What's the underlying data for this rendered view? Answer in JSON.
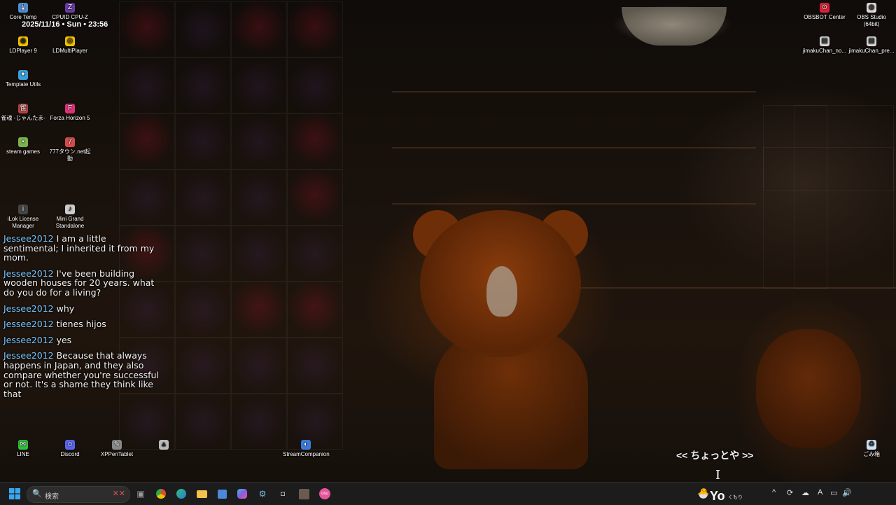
{
  "clock": "2025/11/16 • Sun • 23:56",
  "desktop_icons": [
    {
      "label": "Core Temp",
      "icon": "thermometer-icon",
      "color": "#4a90d9"
    },
    {
      "label": "CPUID CPU-Z",
      "icon": "cpu-z-icon",
      "color": "#6a3aa8"
    },
    {
      "label": "LDPlayer 9",
      "icon": "ldplayer-icon",
      "color": "#f2c200"
    },
    {
      "label": "LDMultiPlayer",
      "icon": "ldmultiplayer-icon",
      "color": "#f2c200"
    },
    {
      "label": "Template Utils",
      "icon": "template-utils-icon",
      "color": "#3aa0d8"
    },
    {
      "label": "雀魂 -じゃんたま-",
      "icon": "mahjong-game-icon",
      "color": "#b84040"
    },
    {
      "label": "Forza Horizon 5",
      "icon": "forza-icon",
      "color": "#e0307a"
    },
    {
      "label": "steam games",
      "icon": "folder-icon",
      "color": "#7ab34a"
    },
    {
      "label": "777タウン.net起動",
      "icon": "slot-town-icon",
      "color": "#d84a4a"
    },
    {
      "label": "iLok License Manager",
      "icon": "ilok-icon",
      "color": "#444444"
    },
    {
      "label": "Mini Grand Standalone",
      "icon": "piano-icon",
      "color": "#cccccc"
    },
    {
      "label": "LINE",
      "icon": "line-icon",
      "color": "#2fbf3a"
    },
    {
      "label": "Discord",
      "icon": "discord-icon",
      "color": "#5865f2"
    },
    {
      "label": "XPPenTablet",
      "icon": "tablet-icon",
      "color": "#888888"
    },
    {
      "label": "",
      "icon": "app-icon",
      "color": "#bbbbbb"
    },
    {
      "label": "StreamCompanion",
      "icon": "stream-companion-icon",
      "color": "#3a7ad8"
    },
    {
      "label": "OBSBOT Center",
      "icon": "obsbot-icon",
      "color": "#e0203a"
    },
    {
      "label": "OBS Studio (64bit)",
      "icon": "obs-icon",
      "color": "#dddddd"
    },
    {
      "label": "jimakuChan_no...",
      "icon": "file-icon",
      "color": "#dddddd"
    },
    {
      "label": "jimakuChan_pre...",
      "icon": "file-icon",
      "color": "#dddddd"
    },
    {
      "label": "ごみ箱",
      "icon": "recycle-bin-icon",
      "color": "#cfe3f5"
    }
  ],
  "chat": [
    {
      "user": "Jessee2012",
      "text": "I am a little sentimental; I inherited it from my mom."
    },
    {
      "user": "Jessee2012",
      "text": "I've been building wooden houses for 20 years. what do you do for a living?"
    },
    {
      "user": "Jessee2012",
      "text": "why"
    },
    {
      "user": "Jessee2012",
      "text": "tienes hijos"
    },
    {
      "user": "Jessee2012",
      "text": "yes"
    },
    {
      "user": "Jessee2012",
      "text": "Because that always happens in Japan, and they also compare whether you're successful or not. It's a shame they think like that"
    }
  ],
  "now_playing": "<< ちょっとや >>",
  "taskbar": {
    "search_placeholder": "検索",
    "weather_text": "Yo",
    "weather_label": "くもり",
    "pinned": [
      {
        "name": "task-view",
        "icon": "task-view-icon",
        "color": "#9a9a9a"
      },
      {
        "name": "chrome",
        "icon": "chrome-icon",
        "color": "#e04a3a"
      },
      {
        "name": "edge",
        "icon": "edge-icon",
        "color": "#2aa0d8"
      },
      {
        "name": "file-explorer",
        "icon": "folder-icon",
        "color": "#f2c24a"
      },
      {
        "name": "store",
        "icon": "store-icon",
        "color": "#4a8ad8"
      },
      {
        "name": "copilot",
        "icon": "copilot-icon",
        "color": "#8a5ae0"
      },
      {
        "name": "steam",
        "icon": "steam-icon",
        "color": "#7ab8e0"
      },
      {
        "name": "capture",
        "icon": "capture-icon",
        "color": "#bbbbbb"
      },
      {
        "name": "game",
        "icon": "game-icon",
        "color": "#8a6a5a"
      },
      {
        "name": "osu",
        "icon": "osu-icon",
        "color": "#e6559a"
      }
    ]
  }
}
